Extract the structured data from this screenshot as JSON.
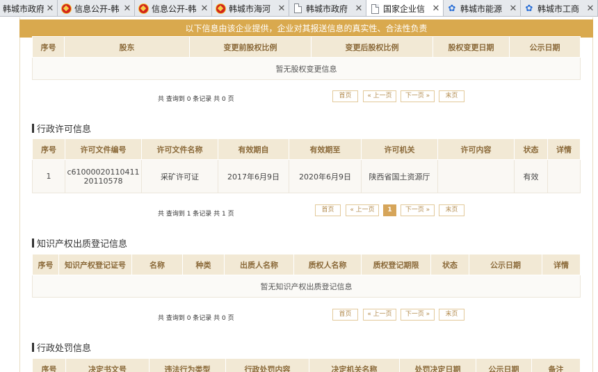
{
  "tabs": [
    {
      "label": "韩城市政府",
      "icon": "none-icon",
      "width": 83
    },
    {
      "label": "信息公开-韩",
      "icon": "emblem-icon",
      "width": 111
    },
    {
      "label": "信息公开-韩",
      "icon": "emblem-icon",
      "width": 111
    },
    {
      "label": "韩城市海河",
      "icon": "emblem-icon",
      "width": 111
    },
    {
      "label": "韩城市政府",
      "icon": "doc-icon",
      "width": 111
    },
    {
      "label": "国家企业信",
      "icon": "doc-icon",
      "width": 111,
      "active": true
    },
    {
      "label": "韩城市能源",
      "icon": "paw-icon",
      "width": 111
    },
    {
      "label": "韩城市工商",
      "icon": "paw-icon",
      "width": 111
    }
  ],
  "notice": "以下信息由该企业提供，企业对其报送信息的真实性、合法性负责",
  "equity_change": {
    "headers": [
      "序号",
      "股东",
      "变更前股权比例",
      "变更后股权比例",
      "股权变更日期",
      "公示日期"
    ],
    "empty": "暂无股权变更信息",
    "summary": "共 查询到 0 条记录 共 0 页",
    "pager": [
      "首页",
      "« 上一页",
      "下一页 »",
      "末页"
    ]
  },
  "admin_license": {
    "title": "行政许可信息",
    "headers": [
      "序号",
      "许可文件编号",
      "许可文件名称",
      "有效期自",
      "有效期至",
      "许可机关",
      "许可内容",
      "状态",
      "详情"
    ],
    "rows": [
      {
        "no": "1",
        "code_line1": "c610000201104​11",
        "code_line2": "20110578",
        "name": "采矿许可证",
        "from": "2017年6月9日",
        "to": "2020年6月9日",
        "authority": "陕西省国土资源厅",
        "content": "",
        "status": "有效",
        "detail": ""
      }
    ],
    "summary": "共 查询到 1 条记录 共 1 页",
    "pager": [
      "首页",
      "« 上一页",
      "1",
      "下一页 »",
      "末页"
    ]
  },
  "ip_pledge": {
    "title": "知识产权出质登记信息",
    "headers": [
      "序号",
      "知识产权登记证号",
      "名称",
      "种类",
      "出质人名称",
      "质权人名称",
      "质权登记期限",
      "状态",
      "公示日期",
      "详情"
    ],
    "empty": "暂无知识产权出质登记信息",
    "summary": "共 查询到 0 条记录 共 0 页",
    "pager": [
      "首页",
      "« 上一页",
      "下一页 »",
      "末页"
    ]
  },
  "admin_penalty": {
    "title": "行政处罚信息",
    "headers": [
      "序号",
      "决定书文号",
      "违法行为类型",
      "行政处罚内容",
      "决定机关名称",
      "处罚决定日期",
      "公示日期",
      "备注"
    ]
  }
}
